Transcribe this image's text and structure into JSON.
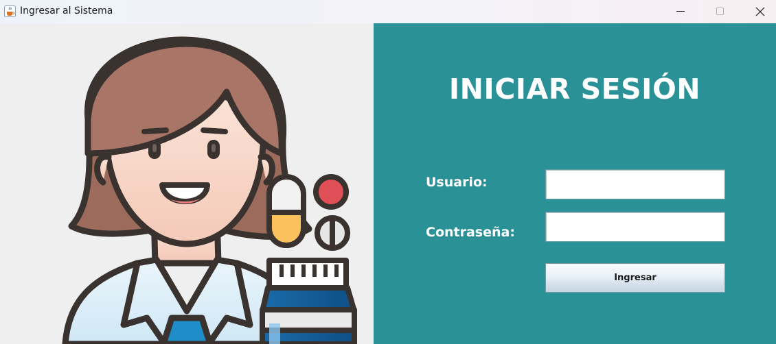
{
  "window": {
    "title": "Ingresar al Sistema",
    "icon": "java-cup-icon",
    "controls": [
      "minimize-icon",
      "maximize-icon",
      "close-icon"
    ]
  },
  "login": {
    "heading": "INICIAR SESIÓN",
    "username_label": "Usuario:",
    "username_value": "",
    "password_label": "Contraseña:",
    "password_value": "",
    "submit_label": "Ingresar"
  },
  "colors": {
    "panel_accent": "#2a9196",
    "left_background": "#efefef"
  },
  "illustration": {
    "subject": "doctor-with-medicine-illustration"
  }
}
